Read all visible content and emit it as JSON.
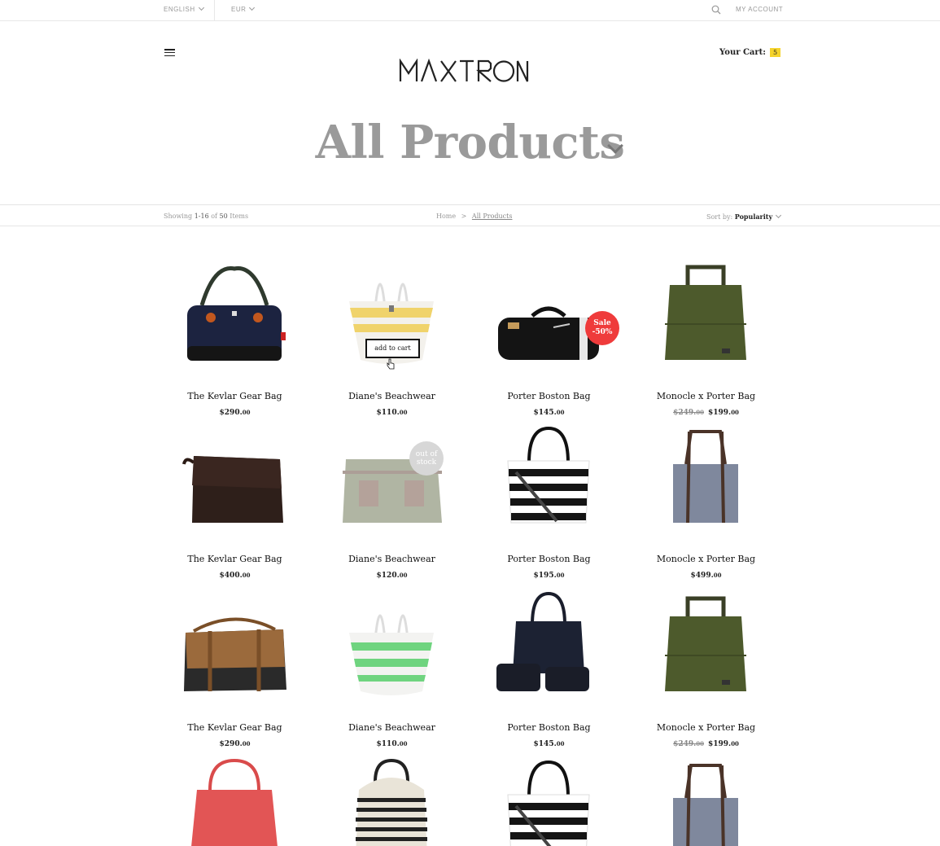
{
  "topbar": {
    "language": "ENGLISH",
    "currency": "EUR",
    "account": "MY ACCOUNT"
  },
  "header": {
    "logo": "MAXTRON",
    "cart_label": "Your Cart:",
    "cart_count": "5"
  },
  "page": {
    "title": "All Products"
  },
  "filterbar": {
    "showing_prefix": "Showing",
    "showing_range": "1-16",
    "showing_of": "of",
    "showing_total": "50",
    "showing_suffix": "Items",
    "crumb_home": "Home",
    "crumb_sep": ">",
    "crumb_current": "All Products",
    "sort_label": "Sort by:",
    "sort_value": "Popularity"
  },
  "products": [
    {
      "name": "The Kevlar Gear Bag",
      "price": "$290.",
      "cents": "00",
      "old": "",
      "old_cents": ""
    },
    {
      "name": "Diane's Beachwear",
      "price": "$110.",
      "cents": "00",
      "old": "",
      "old_cents": "",
      "hover_label": "add to cart"
    },
    {
      "name": "Porter Boston Bag",
      "price": "$145.",
      "cents": "00",
      "old": "",
      "old_cents": "",
      "sale_badge": "Sale -50%"
    },
    {
      "name": "Monocle x Porter Bag",
      "price": "$199.",
      "cents": "00",
      "old": "$249.",
      "old_cents": "00"
    },
    {
      "name": "The Kevlar Gear Bag",
      "price": "$400.",
      "cents": "00",
      "old": "",
      "old_cents": ""
    },
    {
      "name": "Diane's Beachwear",
      "price": "$120.",
      "cents": "00",
      "old": "",
      "old_cents": "",
      "oos_badge": "out of stock"
    },
    {
      "name": "Porter Boston Bag",
      "price": "$195.",
      "cents": "00",
      "old": "",
      "old_cents": ""
    },
    {
      "name": "Monocle x Porter Bag",
      "price": "$499.",
      "cents": "00",
      "old": "",
      "old_cents": ""
    },
    {
      "name": "The Kevlar Gear Bag",
      "price": "$290.",
      "cents": "00",
      "old": "",
      "old_cents": ""
    },
    {
      "name": "Diane's Beachwear",
      "price": "$110.",
      "cents": "00",
      "old": "",
      "old_cents": ""
    },
    {
      "name": "Porter Boston Bag",
      "price": "$145.",
      "cents": "00",
      "old": "",
      "old_cents": ""
    },
    {
      "name": "Monocle x Porter Bag",
      "price": "$199.",
      "cents": "00",
      "old": "$249.",
      "old_cents": "00"
    }
  ],
  "colors": {
    "accent_badge": "#f5d32c",
    "sale": "#ef3b3b",
    "oos": "#d7d7d7"
  }
}
